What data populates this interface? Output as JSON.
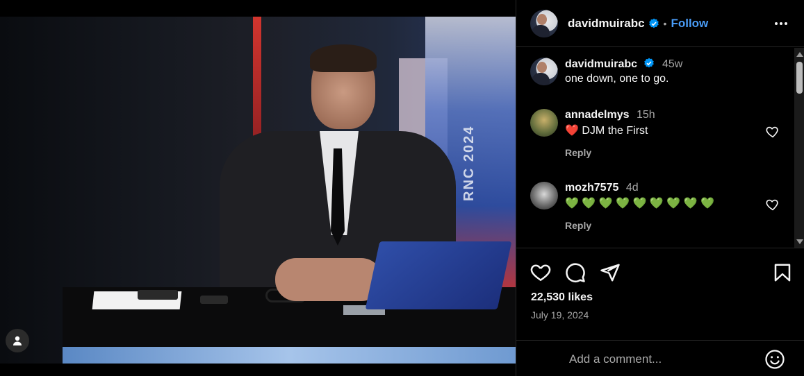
{
  "post": {
    "image_alt": "",
    "rnc_text": "RNC 2024"
  },
  "header": {
    "username": "davidmuirabc",
    "separator": "•",
    "follow_label": "Follow"
  },
  "caption": {
    "username": "davidmuirabc",
    "time": "45w",
    "text": "one down, one to go."
  },
  "comments": [
    {
      "username": "annadelmys",
      "time": "15h",
      "text": "❤️ DJM the First",
      "reply_label": "Reply"
    },
    {
      "username": "mozh7575",
      "time": "4d",
      "text": "💚 💚 💚 💚 💚 💚 💚 💚 💚",
      "reply_label": "Reply"
    }
  ],
  "stats": {
    "likes": "22,530 likes",
    "date": "July 19, 2024"
  },
  "comment_box": {
    "placeholder": "Add a comment..."
  },
  "colors": {
    "accent": "#4a9df8",
    "background": "#000000",
    "muted": "#a8a8a8"
  }
}
